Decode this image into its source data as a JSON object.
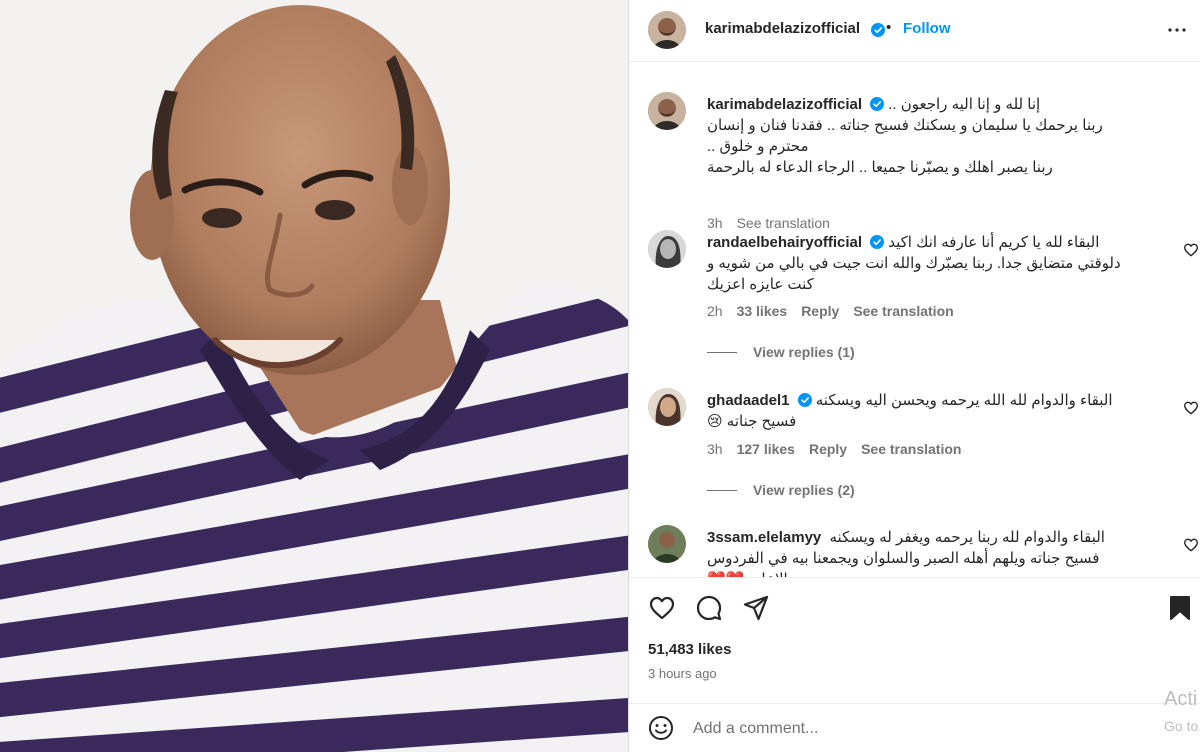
{
  "post": {
    "author": "karimabdelazizofficial",
    "follow_label": "Follow",
    "caption_lines": [
      "إنا لله و إنا اليه راجعون ..",
      "ربنا يرحمك يا سليمان و يسكنك فسيح جناته .. فقدنا فنان و إنسان محترم و خلوق ..",
      "ربنا يصبر اهلك و يصبّرنا جميعا .. الرجاء الدعاء له بالرحمة"
    ],
    "caption_time": "3h",
    "see_translation": "See translation",
    "likes": "51,483 likes",
    "posted": "3 hours ago"
  },
  "comments": [
    {
      "username": "randaelbehairyofficial",
      "verified": true,
      "text": "البقاء لله يا كريم أنا عارفه انك اكيد دلوقتي متضايق جدا. ربنا يصبّرك والله انت جيت في بالي من شويه و كنت عايزه اعزيك",
      "time": "2h",
      "likes": "33 likes",
      "reply": "Reply",
      "see_translation": "See translation",
      "view_replies": "View replies (1)"
    },
    {
      "username": "ghadaadel1",
      "verified": true,
      "text": "البقاء والدوام لله الله يرحمه ويحسن اليه ويسكنه فسيح جناته 😢",
      "time": "3h",
      "likes": "127 likes",
      "reply": "Reply",
      "see_translation": "See translation",
      "view_replies": "View replies (2)"
    },
    {
      "username": "3ssam.elelamyy",
      "verified": false,
      "text": "البقاء والدوام لله ربنا يرحمه ويغفر له ويسكنه فسيح جناته ويلهم أهله الصبر والسلوان ويجمعنا بيه في الفردوس الاعلى ❤️❤️"
    }
  ],
  "add_comment": {
    "placeholder": "Add a comment..."
  },
  "watermark": {
    "line1": "Acti",
    "line2": "Go to"
  },
  "icons": {
    "like": "heart-icon",
    "comment": "comment-bubble-icon",
    "share": "paper-plane-icon",
    "save": "bookmark-icon",
    "emoji": "smiley-icon",
    "more": "more-options-icon",
    "verified": "verified-badge-icon"
  },
  "colors": {
    "accent": "#0095f6",
    "verified": "#0095f6",
    "muted": "#737373",
    "text": "#262626",
    "shirt_stripe_dark": "#3a2a5c"
  }
}
